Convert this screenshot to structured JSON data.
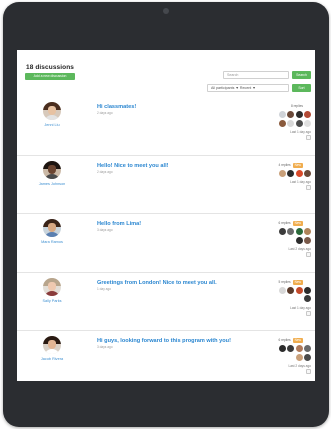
{
  "page": {
    "title": "18 discussions",
    "start_button": "Add a new discussion",
    "search_placeholder": "Search",
    "search_button": "Search",
    "filter_value": "All participants  ▼  Recent ▼",
    "sort_button": "Sort"
  },
  "discussions": [
    {
      "author": "Jenni Liu",
      "subject": "Hi classmates!",
      "posted": "2 days ago",
      "replies": "8 replies",
      "new_badge": "",
      "last_reply": "Last 1 day ago",
      "avatar_colors": {
        "hair": "#4a2e1f",
        "face": "#e7c2a2",
        "body": "#e3e3e3",
        "bg": "#d7c9bb"
      },
      "participants": [
        "#cfd3d8",
        "#6b4a3a",
        "#2c2c2c",
        "#b24a36",
        "#8a5a3c",
        "#d8d8d8",
        "#4c4c4c",
        "#e0e0e0"
      ]
    },
    {
      "author": "James Johnson",
      "subject": "Hello! Nice to meet you all!",
      "posted": "2 days ago",
      "replies": "4 replies",
      "new_badge": "New",
      "last_reply": "Last 1 day ago",
      "avatar_colors": {
        "hair": "#1d1410",
        "face": "#6b4430",
        "body": "#4a4a4a",
        "bg": "#cbb9a6"
      },
      "participants": [
        "#c9a07a",
        "#2c2c2c",
        "#d94a2a",
        "#6a4a3a"
      ]
    },
    {
      "author": "Mara Ramos",
      "subject": "Hello from Lima!",
      "posted": "3 days ago",
      "replies": "6 replies",
      "new_badge": "New",
      "last_reply": "Last 2 days ago",
      "avatar_colors": {
        "hair": "#3b2418",
        "face": "#d8a882",
        "body": "#5a7fb0",
        "bg": "#c9d4dc"
      },
      "participants": [
        "#3b3b3b",
        "#6a6a6a",
        "#2a6a3a",
        "#b0845a",
        "#2c2c2c",
        "#7a5a4a"
      ]
    },
    {
      "author": "Sally Parks",
      "subject": "Greetings from London! Nice to meet you all.",
      "posted": "1 day ago",
      "replies": "5 replies",
      "new_badge": "New",
      "last_reply": "Last 1 day ago",
      "avatar_colors": {
        "hair": "#b8a58c",
        "face": "#efc9b0",
        "body": "#8a3b3b",
        "bg": "#e3ded7"
      },
      "participants": [
        "#d8d8d8",
        "#5a3a2a",
        "#c44a2a",
        "#2c2c2c",
        "#3a3a3a"
      ]
    },
    {
      "author": "Jacob Rivera",
      "subject": "Hi guys, looking forward to this program with you!",
      "posted": "3 days ago",
      "replies": "6 replies",
      "new_badge": "New",
      "last_reply": "Last 2 days ago",
      "avatar_colors": {
        "hair": "#2a1a12",
        "face": "#e2b594",
        "body": "#ffffff",
        "bg": "#d9d0c6"
      },
      "participants": [
        "#2c2c2c",
        "#3a3a3a",
        "#b07a5a",
        "#6a6a6a",
        "#c9a07a",
        "#4a4a4a"
      ]
    }
  ]
}
